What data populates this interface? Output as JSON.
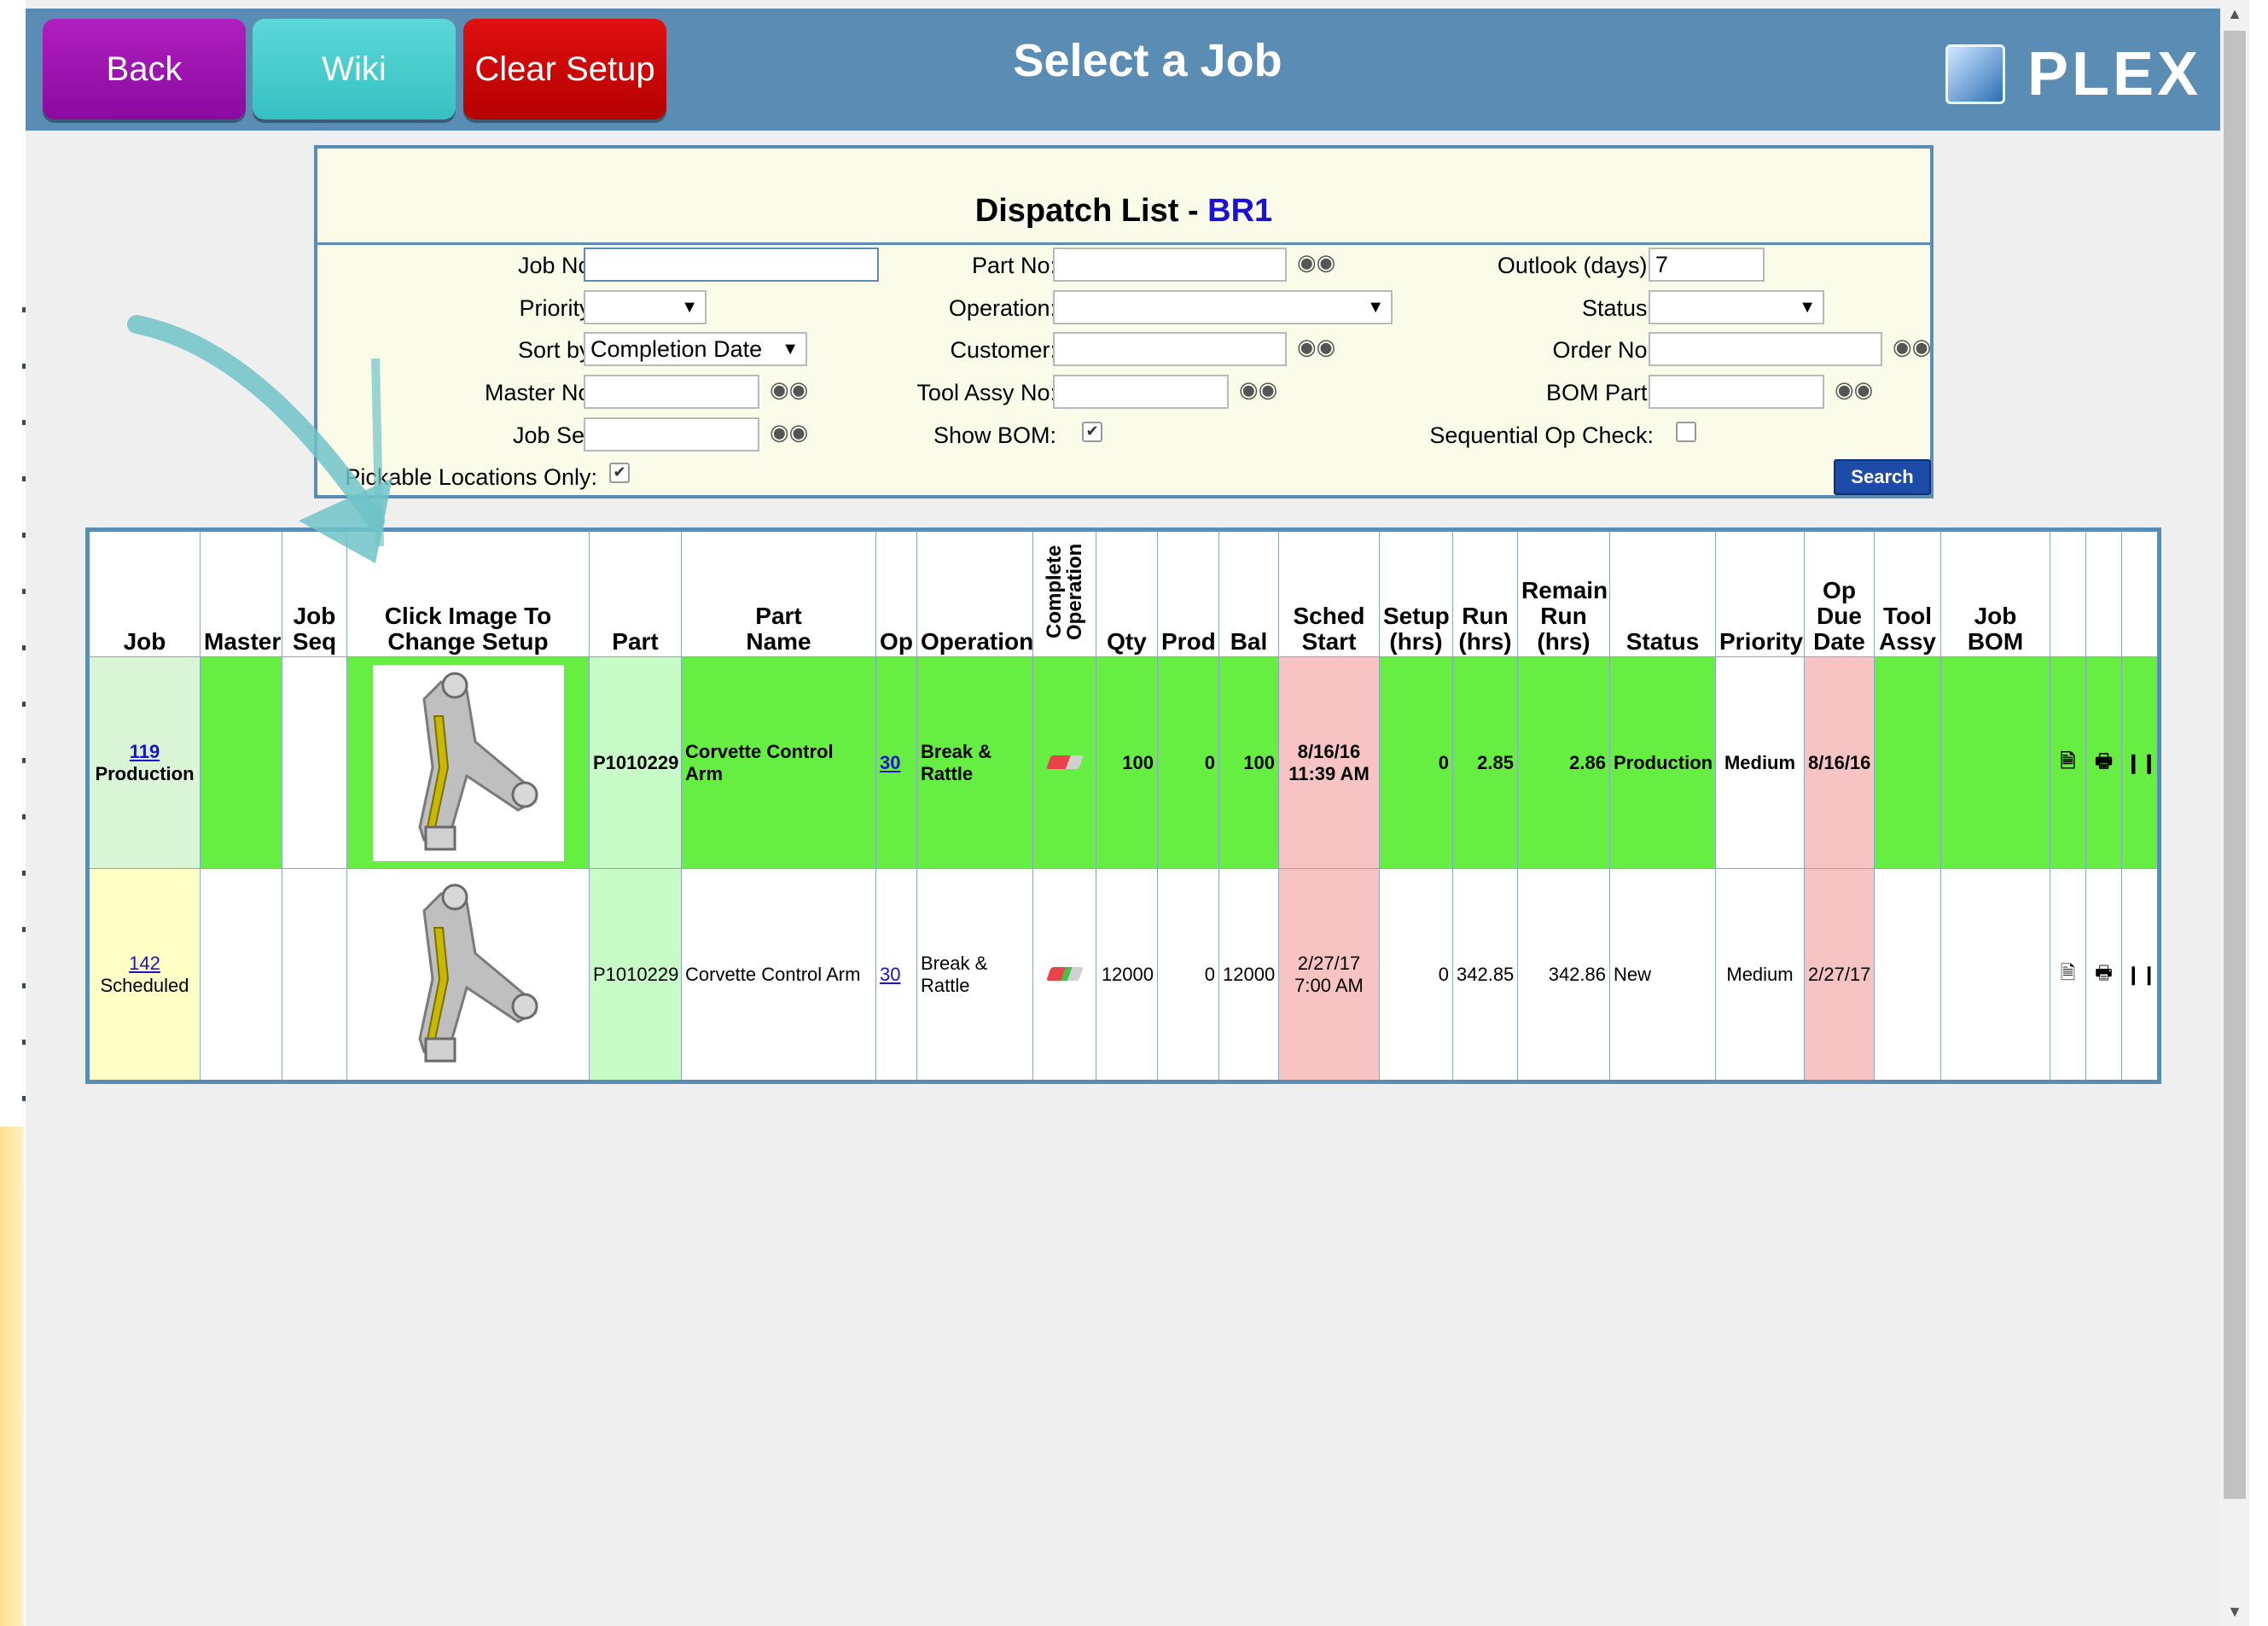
{
  "header": {
    "back_label": "Back",
    "wiki_label": "Wiki",
    "clear_setup_label": "Clear Setup",
    "title": "Select a Job",
    "logo_text": "PLEX"
  },
  "filter": {
    "title_prefix": "Dispatch List - ",
    "title_location": "BR1",
    "job_no": {
      "label": "Job No:",
      "value": ""
    },
    "part_no": {
      "label": "Part No:",
      "value": ""
    },
    "outlook_days": {
      "label": "Outlook (days):",
      "value": "7"
    },
    "priority": {
      "label": "Priority:",
      "value": ""
    },
    "operation": {
      "label": "Operation:",
      "value": ""
    },
    "status": {
      "label": "Status:",
      "value": ""
    },
    "sort_by": {
      "label": "Sort by:",
      "value": "Completion Date"
    },
    "customer": {
      "label": "Customer:",
      "value": ""
    },
    "order_no": {
      "label": "Order No:",
      "value": ""
    },
    "master_no": {
      "label": "Master No:",
      "value": ""
    },
    "tool_assy_no": {
      "label": "Tool Assy No:",
      "value": ""
    },
    "bom_part": {
      "label": "BOM Part:",
      "value": ""
    },
    "job_set": {
      "label": "Job Set:",
      "value": ""
    },
    "show_bom": {
      "label": "Show BOM:",
      "checked": true
    },
    "sequential_op_check": {
      "label": "Sequential Op Check:",
      "checked": false
    },
    "pickable_locations_only": {
      "label": "Pickable Locations Only:",
      "checked": true
    },
    "search_label": "Search"
  },
  "table": {
    "headers": {
      "job": "Job",
      "master": "Master",
      "job_seq_1": "Job",
      "job_seq_2": "Seq",
      "click_image_1": "Click Image To",
      "click_image_2": "Change Setup",
      "part": "Part",
      "part_name_1": "Part",
      "part_name_2": "Name",
      "op": "Op",
      "operation": "Operation",
      "complete_operation": "Complete Operation",
      "qty": "Qty",
      "prod": "Prod",
      "bal": "Bal",
      "sched_start_1": "Sched",
      "sched_start_2": "Start",
      "setup_hrs_1": "Setup",
      "setup_hrs_2": "(hrs)",
      "run_hrs_1": "Run",
      "run_hrs_2": "(hrs)",
      "remain_run_1": "Remain",
      "remain_run_2": "Run",
      "remain_run_3": "(hrs)",
      "status": "Status",
      "priority": "Priority",
      "op_due_1": "Op",
      "op_due_2": "Due",
      "op_due_3": "Date",
      "tool_assy_1": "Tool",
      "tool_assy_2": "Assy",
      "job_bom": "Job BOM"
    },
    "rows": [
      {
        "job_no": "119",
        "job_status": "Production",
        "part": "P1010229",
        "part_name": "Corvette Control Arm",
        "op": "30",
        "operation_1": "Break &",
        "operation_2": "Rattle",
        "qty": "100",
        "prod": "0",
        "bal": "100",
        "sched_start_1": "8/16/16",
        "sched_start_2": "11:39 AM",
        "setup_hrs": "0",
        "run_hrs": "2.85",
        "remain_run_hrs": "2.86",
        "status": "Production",
        "priority": "Medium",
        "op_due_date": "8/16/16"
      },
      {
        "job_no": "142",
        "job_status": "Scheduled",
        "part": "P1010229",
        "part_name": "Corvette Control Arm",
        "op": "30",
        "operation_1": "Break &",
        "operation_2": "Rattle",
        "qty": "12000",
        "prod": "0",
        "bal": "12000",
        "sched_start_1": "2/27/17",
        "sched_start_2": "7:00 AM",
        "setup_hrs": "0",
        "run_hrs": "342.85",
        "remain_run_hrs": "342.86",
        "status": "New",
        "priority": "Medium",
        "op_due_date": "2/27/17"
      }
    ]
  },
  "colors": {
    "header_bg": "#5b8db4",
    "production_row": "#66ee42",
    "sched_pink": "#f8c3c3",
    "link_blue": "#1a10d8"
  },
  "icons": [
    "binoculars-icon",
    "dropdown-arrow-icon",
    "checkbox-icon",
    "complete-operation-icon",
    "document-icon",
    "printer-icon",
    "barcode-icon",
    "plex-logo-icon"
  ]
}
